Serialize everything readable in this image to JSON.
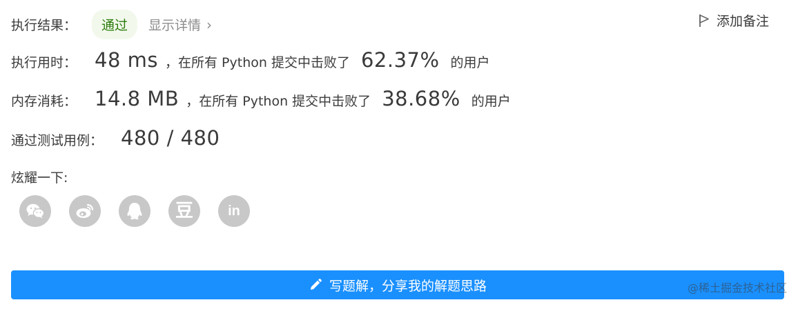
{
  "result": {
    "label": "执行结果：",
    "status": "通过",
    "details_link": "显示详情",
    "add_note": "添加备注"
  },
  "runtime": {
    "label": "执行用时：",
    "value": "48 ms",
    "mid_text": "，在所有 Python 提交中击败了",
    "percent": "62.37%",
    "suffix": "的用户"
  },
  "memory": {
    "label": "内存消耗：",
    "value": "14.8 MB",
    "mid_text": "，在所有 Python 提交中击败了",
    "percent": "38.68%",
    "suffix": "的用户"
  },
  "tests": {
    "label": "通过测试用例：",
    "value": "480 / 480"
  },
  "share": {
    "label": "炫耀一下:",
    "icons": [
      "wechat-icon",
      "weibo-icon",
      "qq-icon",
      "douban-icon",
      "linkedin-icon"
    ],
    "douban_glyph": "豆",
    "linkedin_glyph": "in"
  },
  "write_solution_button": "写题解，分享我的解题思路",
  "watermark": "@稀土掘金技术社区",
  "colors": {
    "accent_blue": "#1a90ff",
    "pass_green": "#2b7a0b",
    "pass_bg": "#f2f9ec",
    "icon_gray": "#c8c8c8"
  }
}
